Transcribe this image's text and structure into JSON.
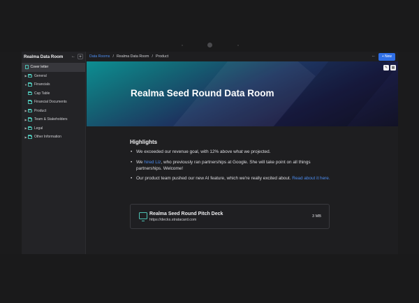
{
  "sidebar": {
    "title": "Realma Data Room",
    "collapse_symbol": "←",
    "add_symbol": "+",
    "items": [
      {
        "label": "Cover letter",
        "type": "doc",
        "selected": true
      },
      {
        "label": "General",
        "type": "folder"
      },
      {
        "label": "Financials",
        "type": "folder"
      },
      {
        "label": "Cap Table",
        "type": "folder"
      },
      {
        "label": "Financial Documents",
        "type": "folder"
      },
      {
        "label": "Product",
        "type": "folder"
      },
      {
        "label": "Team & Stakeholders",
        "type": "folder"
      },
      {
        "label": "Legal",
        "type": "folder"
      },
      {
        "label": "Other Information",
        "type": "folder"
      }
    ]
  },
  "topbar": {
    "breadcrumb": [
      "Data Rooms",
      "Realma Data Room",
      "Product"
    ],
    "separator": "/",
    "more_label": "···",
    "new_button": "+ New"
  },
  "banner": {
    "title": "Realma Seed Round Data Room",
    "edit_icon": "✎",
    "grid_icon": "▦"
  },
  "content": {
    "heading": "Highlights",
    "bullet1": "We exceeded our revenue goal, with 12% above what we projected.",
    "bullet2_pre": "We ",
    "bullet2_link": "hired Liz",
    "bullet2_post": ", who previously ran partnerships at Google. She will take point on all things partnerships. Welcome!",
    "bullet3_pre": "Our product team pushed our new AI feature, which we're really excited about. ",
    "bullet3_link": "Read about it here."
  },
  "card": {
    "title": "Realma Seed Round Pitch Deck",
    "url": "https://decks.stratacard.com",
    "size": "3 MB"
  },
  "colors": {
    "accent": "#2f6fe6",
    "link": "#4d8df0",
    "folder": "#4ec3b5"
  },
  "icons": {
    "folder": "folder-icon",
    "document": "document-icon",
    "presentation": "presentation-icon"
  }
}
